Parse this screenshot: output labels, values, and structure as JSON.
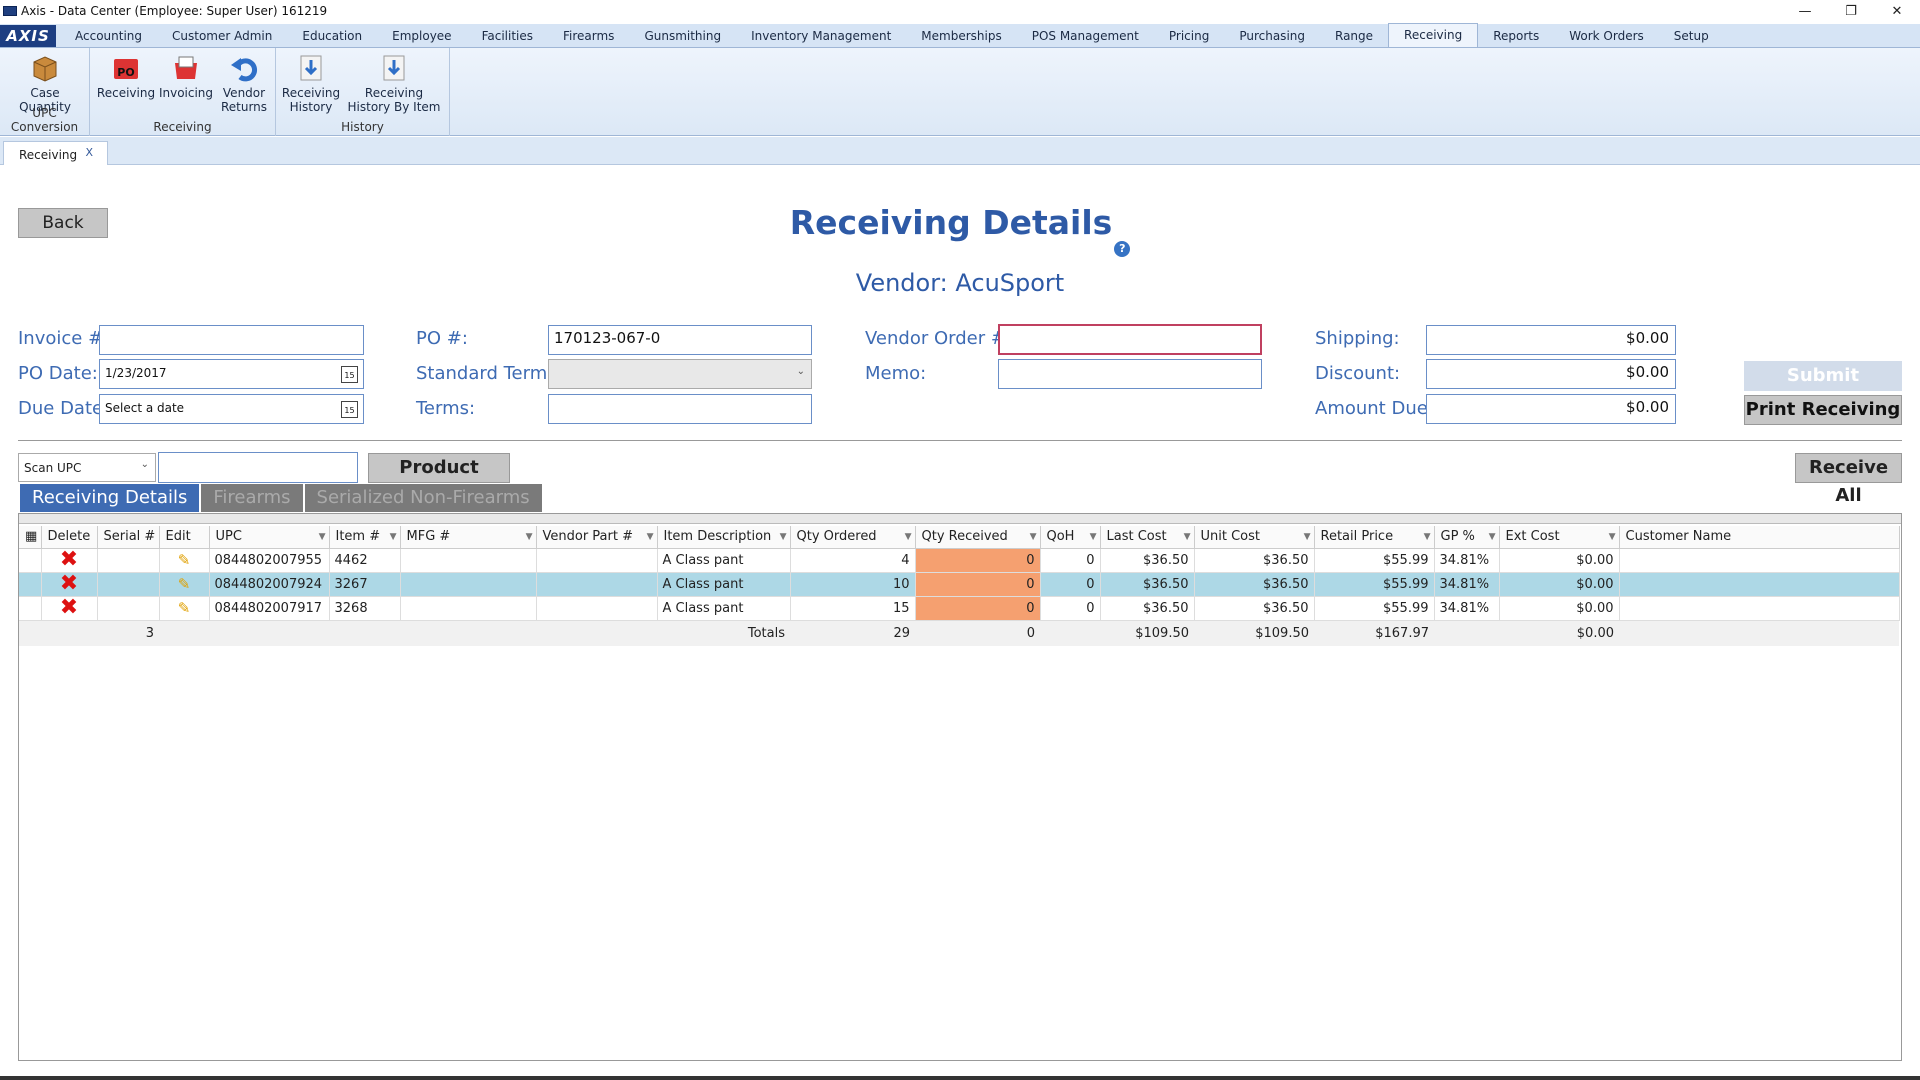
{
  "window": {
    "title": "Axis - Data Center  (Employee: Super User) 161219",
    "minimize": "—",
    "maximize": "❐",
    "close": "✕"
  },
  "menu": {
    "logo": "AXIS",
    "tabs": [
      "Accounting",
      "Customer Admin",
      "Education",
      "Employee",
      "Facilities",
      "Firearms",
      "Gunsmithing",
      "Inventory Management",
      "Memberships",
      "POS Management",
      "Pricing",
      "Purchasing",
      "Range",
      "Receiving",
      "Reports",
      "Work Orders",
      "Setup"
    ],
    "active": "Receiving"
  },
  "ribbon": {
    "groups": [
      {
        "label": "UPC Conversion",
        "buttons": [
          {
            "label": "Case Quantity",
            "icon": "box-icon"
          }
        ]
      },
      {
        "label": "Receiving",
        "buttons": [
          {
            "label": "Receiving",
            "icon": "po-icon"
          },
          {
            "label": "Invoicing",
            "icon": "invoice-icon"
          },
          {
            "label": "Vendor Returns",
            "icon": "return-icon"
          }
        ]
      },
      {
        "label": "History",
        "buttons": [
          {
            "label": "Receiving History",
            "icon": "download-icon"
          },
          {
            "label": "Receiving History By Item",
            "icon": "download-icon"
          }
        ]
      }
    ]
  },
  "doc_tab": {
    "label": "Receiving",
    "close": "X"
  },
  "page": {
    "back_label": "Back",
    "title": "Receiving Details",
    "help": "?",
    "vendor": "Vendor: AcuSport"
  },
  "form": {
    "invoice_label": "Invoice #:",
    "invoice_value": "",
    "po_date_label": "PO Date:",
    "po_date_value": "1/23/2017",
    "due_date_label": "Due Date:",
    "due_date_placeholder": "Select a date",
    "calendar": "15",
    "po_label": "PO #:",
    "po_value": "170123-067-0",
    "std_terms_label": "Standard Terms:",
    "std_terms_value": "",
    "terms_label": "Terms:",
    "terms_value": "",
    "vendor_order_label": "Vendor Order #:",
    "vendor_order_value": "",
    "memo_label": "Memo:",
    "memo_value": "",
    "shipping_label": "Shipping:",
    "shipping_value": "$0.00",
    "discount_label": "Discount:",
    "discount_value": "$0.00",
    "amount_due_label": "Amount Due:",
    "amount_due_value": "$0.00",
    "submit_label": "Submit",
    "print_label": "Print Receiving"
  },
  "search": {
    "mode": "Scan UPC",
    "value": "",
    "product_search_label": "Product Search",
    "receive_all_label": "Receive All"
  },
  "subtabs": [
    "Receiving Details",
    "Firearms",
    "Serialized Non-Firearms"
  ],
  "grid": {
    "columns": [
      "Delete",
      "Serial #",
      "Edit",
      "UPC",
      "Item #",
      "MFG #",
      "Vendor Part #",
      "Item Description",
      "Qty Ordered",
      "Qty Received",
      "QoH",
      "Last Cost",
      "Unit Cost",
      "Retail Price",
      "GP %",
      "Ext Cost",
      "Customer Name"
    ],
    "rows": [
      {
        "serial": "",
        "upc": "0844802007955",
        "item": "4462",
        "mfg": "",
        "vendor_part": "",
        "desc": "A Class pant",
        "qty_ordered": "4",
        "qty_received": "0",
        "qoh": "0",
        "last_cost": "$36.50",
        "unit_cost": "$36.50",
        "retail": "$55.99",
        "gp": "34.81%",
        "ext_cost": "$0.00",
        "customer": ""
      },
      {
        "serial": "",
        "upc": "0844802007924",
        "item": "3267",
        "mfg": "",
        "vendor_part": "",
        "desc": "A Class pant",
        "qty_ordered": "10",
        "qty_received": "0",
        "qoh": "0",
        "last_cost": "$36.50",
        "unit_cost": "$36.50",
        "retail": "$55.99",
        "gp": "34.81%",
        "ext_cost": "$0.00",
        "customer": ""
      },
      {
        "serial": "",
        "upc": "0844802007917",
        "item": "3268",
        "mfg": "",
        "vendor_part": "",
        "desc": "A Class pant",
        "qty_ordered": "15",
        "qty_received": "0",
        "qoh": "0",
        "last_cost": "$36.50",
        "unit_cost": "$36.50",
        "retail": "$55.99",
        "gp": "34.81%",
        "ext_cost": "$0.00",
        "customer": ""
      }
    ],
    "totals": {
      "count": "3",
      "label": "Totals",
      "qty_ordered": "29",
      "qty_received": "0",
      "last_cost": "$109.50",
      "unit_cost": "$109.50",
      "retail": "$167.97",
      "ext_cost": "$0.00"
    }
  },
  "colors": {
    "accent": "#2e5aa6",
    "selected_row": "#add8e6",
    "qty_highlight": "#f5a070"
  }
}
